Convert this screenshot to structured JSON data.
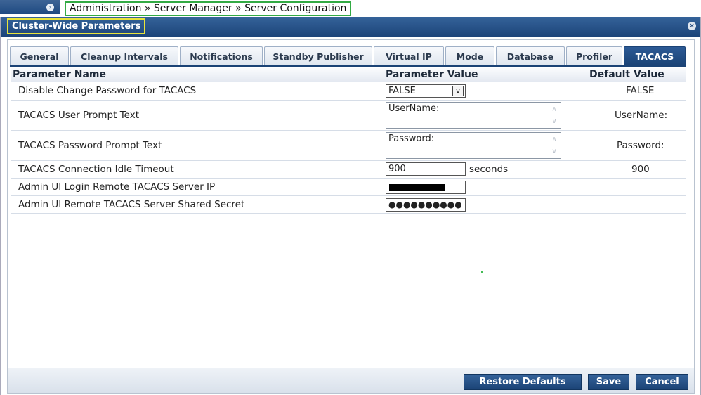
{
  "breadcrumb": "Administration » Server Manager » Server Configuration",
  "dialog": {
    "title": "Cluster-Wide Parameters",
    "close_icon": "close-icon"
  },
  "tabs": [
    {
      "label": "General"
    },
    {
      "label": "Cleanup Intervals"
    },
    {
      "label": "Notifications"
    },
    {
      "label": "Standby Publisher"
    },
    {
      "label": "Virtual IP"
    },
    {
      "label": "Mode"
    },
    {
      "label": "Database"
    },
    {
      "label": "Profiler"
    },
    {
      "label": "TACACS",
      "active": true
    }
  ],
  "table": {
    "headers": {
      "name": "Parameter Name",
      "value": "Parameter Value",
      "default": "Default Value"
    },
    "rows": [
      {
        "name": "Disable Change Password for TACACS",
        "value": "FALSE",
        "default": "FALSE"
      },
      {
        "name": "TACACS User Prompt Text",
        "value": "UserName:",
        "default": "UserName:"
      },
      {
        "name": "TACACS Password Prompt Text",
        "value": "Password:",
        "default": "Password:"
      },
      {
        "name": "TACACS Connection Idle Timeout",
        "value": "900",
        "unit": "seconds",
        "default": "900"
      },
      {
        "name": "Admin UI Login Remote TACACS Server IP",
        "value": "",
        "default": ""
      },
      {
        "name": "Admin UI Remote TACACS Server Shared Secret",
        "value": "●●●●●●●●●●",
        "default": ""
      }
    ]
  },
  "footer": {
    "restore_label": "Restore Defaults",
    "save_label": "Save",
    "cancel_label": "Cancel"
  },
  "colors": {
    "accent": "#1b4376",
    "breadcrumb_border": "#33aa44",
    "title_highlight": "#e8e43a"
  }
}
